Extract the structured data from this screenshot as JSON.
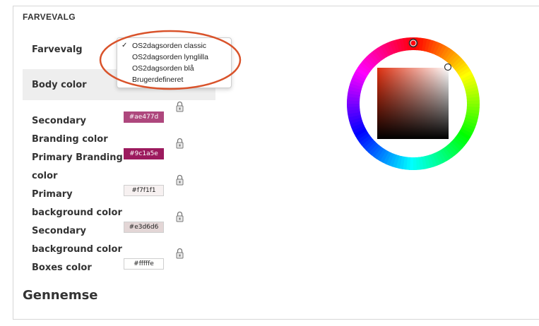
{
  "section": {
    "title": "FARVEVALG"
  },
  "form": {
    "farvevalg_label": "Farvevalg",
    "body_color_label": "Body color"
  },
  "dropdown": {
    "checkmark": "✓",
    "options": [
      "OS2dagsorden classic",
      "OS2dagsorden lynglilla",
      "OS2dagsorden blå",
      "Brugerdefineret"
    ],
    "selected_index": 0
  },
  "labels": [
    "Secondary",
    "Branding color",
    "Primary Branding",
    "color",
    "Primary",
    "background color",
    "Secondary",
    "background color",
    "Boxes color"
  ],
  "swatches": [
    {
      "value": "#ae477d",
      "color": "#ae477d"
    },
    {
      "value": "#9c1a5e",
      "color": "#9c1a5e"
    },
    {
      "value": "#f7f1f1",
      "color": "#f7f1f1"
    },
    {
      "value": "#e3d6d6",
      "color": "#e3d6d6"
    },
    {
      "value": "#fffffe",
      "color": "#fffffe"
    }
  ],
  "locks": [
    "lock-icon",
    "lock-icon",
    "lock-icon",
    "lock-icon",
    "lock-icon"
  ],
  "footer": {
    "heading": "Gennemse"
  },
  "colors": {
    "accent_ellipse": "#d9532b",
    "row_highlight": "#eeeeee"
  }
}
